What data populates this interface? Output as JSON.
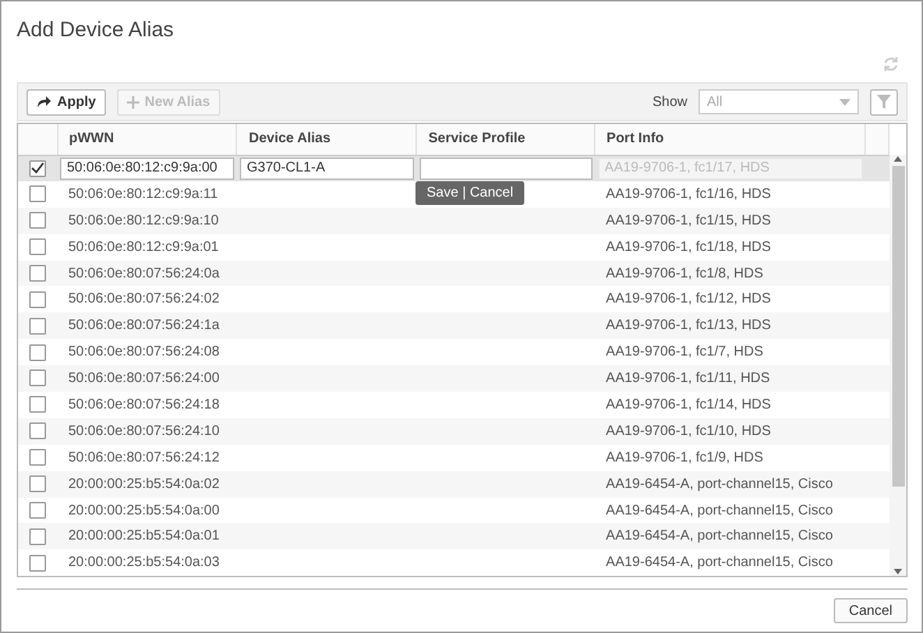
{
  "dialog": {
    "title": "Add Device Alias"
  },
  "toolbar": {
    "apply": {
      "label": "Apply",
      "disabled": false
    },
    "new_alias": {
      "label": "New Alias",
      "disabled": true
    },
    "show_label": "Show",
    "show_select": {
      "value": "All",
      "disabled": true
    }
  },
  "table": {
    "columns": [
      "pWWN",
      "Device Alias",
      "Service Profile",
      "Port Info"
    ],
    "rows": [
      {
        "kind": "edit",
        "checked": true,
        "pwwn": "50:06:0e:80:12:c9:9a:00",
        "device_alias": "G370-CL1-A",
        "port_info": "AA19-9706-1, fc1/17, HDS"
      },
      {
        "kind": "plain",
        "checked": false,
        "pwwn": "50:06:0e:80:12:c9:9a:11",
        "port_info": "AA19-9706-1, fc1/16, HDS"
      },
      {
        "kind": "plain",
        "checked": false,
        "pwwn": "50:06:0e:80:12:c9:9a:10",
        "port_info": "AA19-9706-1, fc1/15, HDS"
      },
      {
        "kind": "plain",
        "checked": false,
        "pwwn": "50:06:0e:80:12:c9:9a:01",
        "port_info": "AA19-9706-1, fc1/18, HDS"
      },
      {
        "kind": "plain",
        "checked": false,
        "pwwn": "50:06:0e:80:07:56:24:0a",
        "port_info": "AA19-9706-1, fc1/8, HDS"
      },
      {
        "kind": "plain",
        "checked": false,
        "pwwn": "50:06:0e:80:07:56:24:02",
        "port_info": "AA19-9706-1, fc1/12, HDS"
      },
      {
        "kind": "plain",
        "checked": false,
        "pwwn": "50:06:0e:80:07:56:24:1a",
        "port_info": "AA19-9706-1, fc1/13, HDS"
      },
      {
        "kind": "plain",
        "checked": false,
        "pwwn": "50:06:0e:80:07:56:24:08",
        "port_info": "AA19-9706-1, fc1/7, HDS"
      },
      {
        "kind": "plain",
        "checked": false,
        "pwwn": "50:06:0e:80:07:56:24:00",
        "port_info": "AA19-9706-1, fc1/11, HDS"
      },
      {
        "kind": "plain",
        "checked": false,
        "pwwn": "50:06:0e:80:07:56:24:18",
        "port_info": "AA19-9706-1, fc1/14, HDS"
      },
      {
        "kind": "plain",
        "checked": false,
        "pwwn": "50:06:0e:80:07:56:24:10",
        "port_info": "AA19-9706-1, fc1/10, HDS"
      },
      {
        "kind": "plain",
        "checked": false,
        "pwwn": "50:06:0e:80:07:56:24:12",
        "port_info": "AA19-9706-1, fc1/9, HDS"
      },
      {
        "kind": "plain",
        "checked": false,
        "pwwn": "20:00:00:25:b5:54:0a:02",
        "port_info": "AA19-6454-A, port-channel15, Cisco"
      },
      {
        "kind": "plain",
        "checked": false,
        "pwwn": "20:00:00:25:b5:54:0a:00",
        "port_info": "AA19-6454-A, port-channel15, Cisco"
      },
      {
        "kind": "plain",
        "checked": false,
        "pwwn": "20:00:00:25:b5:54:0a:01",
        "port_info": "AA19-6454-A, port-channel15, Cisco"
      },
      {
        "kind": "plain",
        "checked": false,
        "pwwn": "20:00:00:25:b5:54:0a:03",
        "port_info": "AA19-6454-A, port-channel15, Cisco"
      }
    ]
  },
  "edit_tooltip": "Save | Cancel",
  "footer": {
    "cancel": "Cancel"
  }
}
